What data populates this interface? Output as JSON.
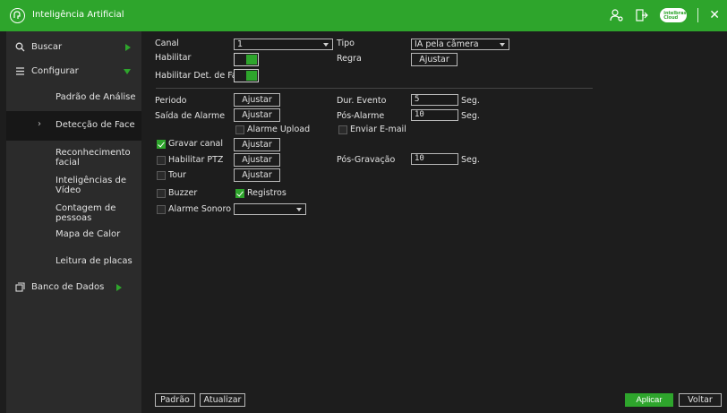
{
  "app": {
    "title": "Inteligência Artificial"
  },
  "sidebar": {
    "items": [
      {
        "label": "Buscar"
      },
      {
        "label": "Configurar"
      },
      {
        "label": "Padrão de Análise"
      },
      {
        "label": "Detecção de Face"
      },
      {
        "label": "Reconhecimento facial"
      },
      {
        "label": "Inteligências de Vídeo"
      },
      {
        "label": "Contagem de pessoas"
      },
      {
        "label": "Mapa de Calor"
      },
      {
        "label": "Leitura de placas"
      },
      {
        "label": "Banco de Dados"
      }
    ]
  },
  "form": {
    "canal_label": "Canal",
    "canal_value": "1",
    "tipo_label": "Tipo",
    "tipo_value": "IA pela câmera",
    "habilitar_label": "Habilitar",
    "regra_label": "Regra",
    "regra_button": "Ajustar",
    "habilitar_det_label": "Habilitar Det. de Face",
    "periodo_label": "Periodo",
    "periodo_button": "Ajustar",
    "dur_evento_label": "Dur. Evento",
    "dur_evento_value": "5",
    "dur_evento_unit": "Seg.",
    "saida_alarme_label": "Saída de Alarme",
    "saida_alarme_button": "Ajustar",
    "pos_alarme_label": "Pós-Alarme",
    "pos_alarme_value": "10",
    "pos_alarme_unit": "Seg.",
    "alarme_upload_label": "Alarme Upload",
    "enviar_email_label": "Enviar E-mail",
    "gravar_canal_label": "Gravar canal",
    "gravar_canal_button": "Ajustar",
    "habilitar_ptz_label": "Habilitar PTZ",
    "habilitar_ptz_button": "Ajustar",
    "pos_gravacao_label": "Pós-Gravação",
    "pos_gravacao_value": "10",
    "pos_gravacao_unit": "Seg.",
    "tour_label": "Tour",
    "tour_button": "Ajustar",
    "buzzer_label": "Buzzer",
    "registros_label": "Registros",
    "alarme_sonoro_label": "Alarme Sonoro",
    "alarme_sonoro_value": ""
  },
  "footer": {
    "padrao": "Padrão",
    "atualizar": "Atualizar",
    "aplicar": "Aplicar",
    "voltar": "Voltar"
  },
  "top_icons": [
    "user-settings-icon",
    "logout-icon",
    "cloud-icon",
    "close-icon"
  ],
  "cloud_text": "Intelbras Cloud",
  "colors": {
    "accent": "#2ea52c",
    "background": "#1d1d1d",
    "sidebar": "#2b2b2b"
  }
}
